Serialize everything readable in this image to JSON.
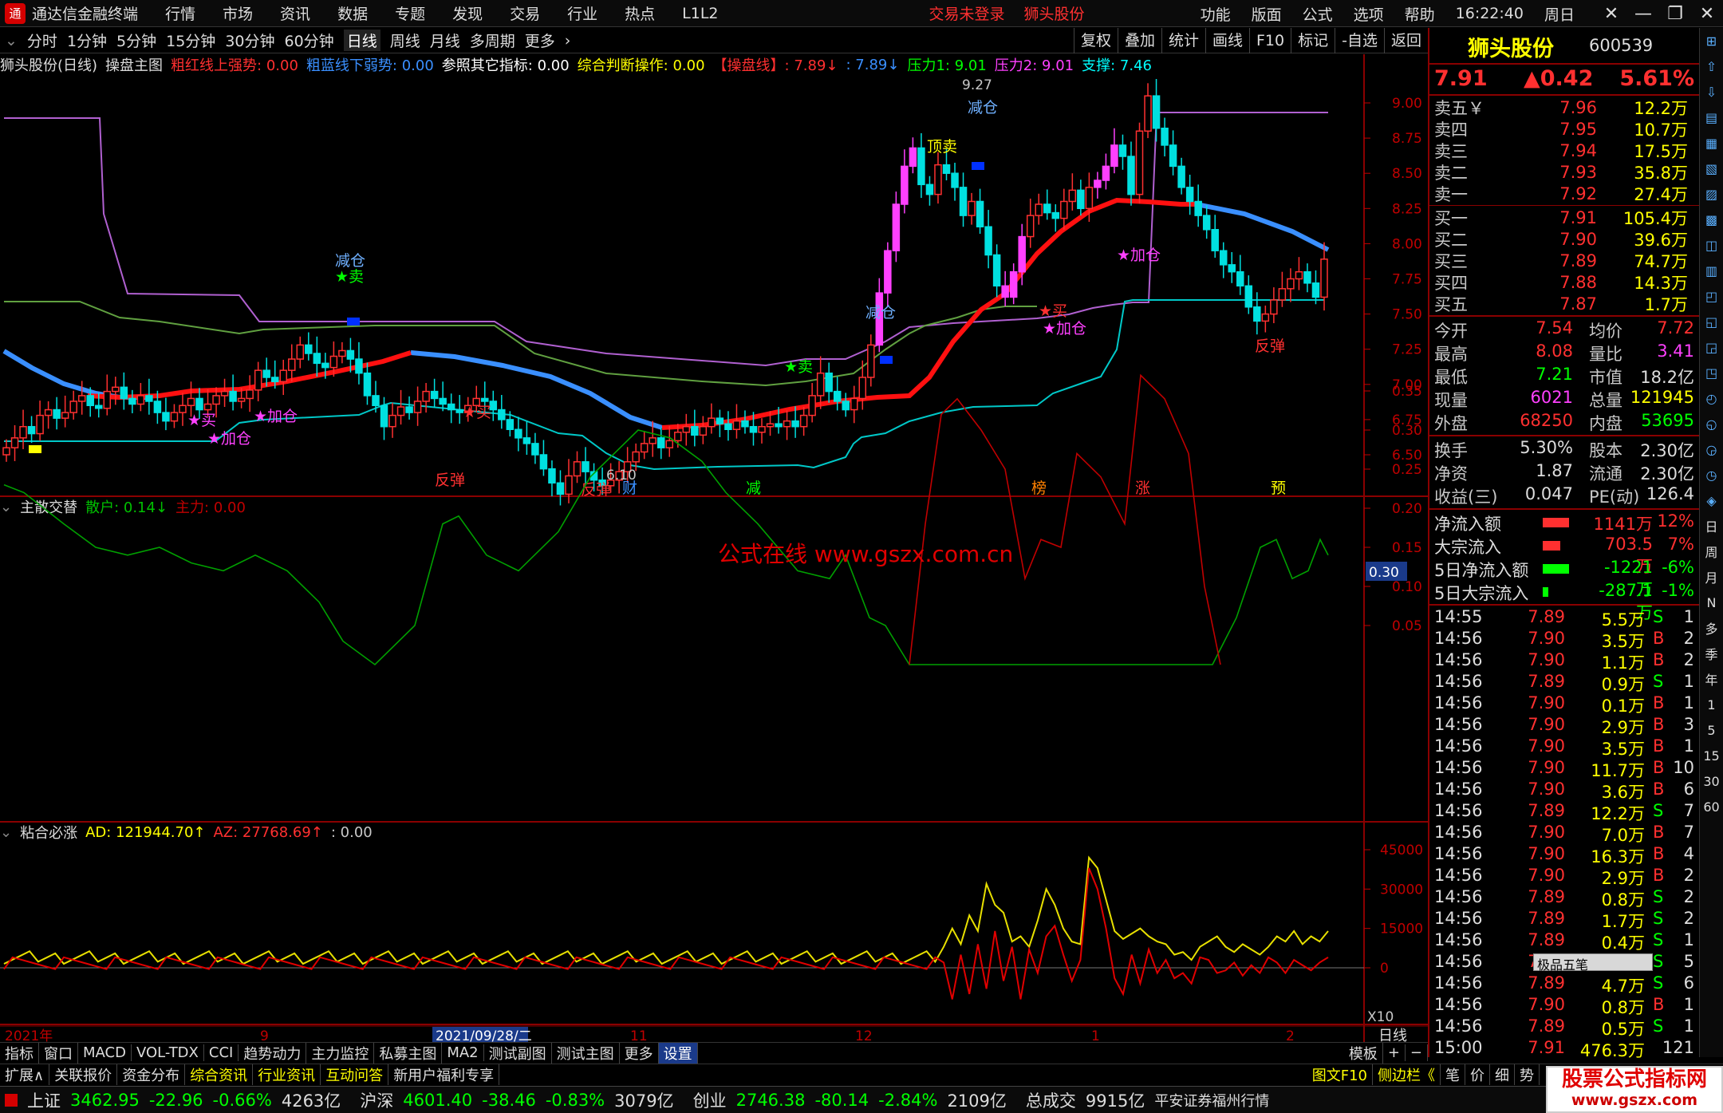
{
  "titlebar": {
    "logo": "通",
    "app": "通达信金融终端",
    "menu": [
      "行情",
      "市场",
      "资讯",
      "数据",
      "专题",
      "发现",
      "交易",
      "行业",
      "热点",
      "L1L2"
    ],
    "login": "交易未登录",
    "stock": "狮头股份",
    "right": [
      "功能",
      "版面",
      "公式",
      "选项",
      "帮助"
    ],
    "time": "16:22:40",
    "weekday": "周日"
  },
  "period": {
    "items": [
      "分时",
      "1分钟",
      "5分钟",
      "15分钟",
      "30分钟",
      "60分钟",
      "日线",
      "周线",
      "月线",
      "多周期",
      "更多"
    ],
    "active": "日线",
    "tools": [
      "复权",
      "叠加",
      "统计",
      "画线",
      "F10",
      "标记",
      "-自选",
      "返回"
    ]
  },
  "panel1": {
    "name": "狮头股份(日线)",
    "formula": "操盘主图",
    "items": [
      {
        "t": "粗红线上强势: 0.00",
        "c": "#ff3030"
      },
      {
        "t": "粗蓝线下弱势: 0.00",
        "c": "#3a8fff"
      },
      {
        "t": "参照其它指标: 0.00",
        "c": "#ffffff"
      },
      {
        "t": "综合判断操作: 0.00",
        "c": "#ffff00"
      },
      {
        "t": "【操盘线】: 7.89↓",
        "c": "#ff3030"
      },
      {
        "t": ": 7.89↓",
        "c": "#3a8fff"
      },
      {
        "t": "压力1: 9.01",
        "c": "#00ff00"
      },
      {
        "t": "压力2: 9.01",
        "c": "#ff40ff"
      },
      {
        "t": "支撑: 7.46",
        "c": "#00ffff"
      }
    ]
  },
  "panel2": {
    "name": "主散交替",
    "items": [
      {
        "t": "散户: 0.14↓",
        "c": "#00c000"
      },
      {
        "t": "主力: 0.00",
        "c": "#c00000"
      }
    ],
    "watermark": "公式在线 www.gszx.com.cn",
    "axis_tag": "0.30"
  },
  "panel3": {
    "name": "粘合必涨",
    "items": [
      {
        "t": "AD: 121944.70↑",
        "c": "#ffff00"
      },
      {
        "t": "AZ: 27768.69↑",
        "c": "#ff3030"
      },
      {
        "t": ": 0.00",
        "c": "#c8c8c8"
      }
    ],
    "scale_tag": "X10"
  },
  "price_axis": [
    "9.00",
    "8.75",
    "8.50",
    "8.25",
    "8.00",
    "7.75",
    "7.50",
    "7.25",
    "7.00",
    "6.75",
    "6.50"
  ],
  "osc_axis": [
    "0.35",
    "0.30",
    "0.25",
    "0.20",
    "0.15",
    "0.10",
    "0.05"
  ],
  "vol_axis": [
    "45000",
    "30000",
    "15000",
    "0"
  ],
  "time_axis": {
    "labels": [
      "2021年",
      "9",
      "2021/09/28/二",
      "11",
      "12",
      "1",
      "2"
    ],
    "period": "日线"
  },
  "chart_labels": {
    "high": "9.27",
    "low": "6.10",
    "signals": [
      "减仓",
      "★卖",
      "★买",
      "★加仓",
      "★加仓",
      "反弹",
      "★买",
      "反弹",
      "★卖",
      "减仓",
      "顶卖",
      "减仓",
      "★买",
      "★加仓",
      "★加仓",
      "反弹"
    ],
    "bottom_tags": [
      "财",
      "减",
      "榜",
      "涨",
      "预"
    ]
  },
  "quote": {
    "name": "狮头股份",
    "code": "600539",
    "price": "7.91",
    "change": "▲0.42",
    "pct": "5.61%",
    "asks": [
      {
        "l": "卖五￥",
        "p": "7.96",
        "v": "12.2万"
      },
      {
        "l": "卖四",
        "p": "7.95",
        "v": "10.7万"
      },
      {
        "l": "卖三",
        "p": "7.94",
        "v": "17.5万"
      },
      {
        "l": "卖二",
        "p": "7.93",
        "v": "35.8万"
      },
      {
        "l": "卖一",
        "p": "7.92",
        "v": "27.4万"
      }
    ],
    "bids": [
      {
        "l": "买一",
        "p": "7.91",
        "v": "105.4万"
      },
      {
        "l": "买二",
        "p": "7.90",
        "v": "39.6万"
      },
      {
        "l": "买三",
        "p": "7.89",
        "v": "74.7万"
      },
      {
        "l": "买四",
        "p": "7.88",
        "v": "14.3万"
      },
      {
        "l": "买五",
        "p": "7.87",
        "v": "1.7万"
      }
    ],
    "stats": [
      [
        "今开",
        "7.54",
        "均价",
        "7.72"
      ],
      [
        "最高",
        "8.08",
        "量比",
        "3.41"
      ],
      [
        "最低",
        "7.21",
        "市值",
        "18.2亿"
      ],
      [
        "现量",
        "6021",
        "总量",
        "121945"
      ],
      [
        "外盘",
        "68250",
        "内盘",
        "53695"
      ]
    ],
    "stats2": [
      [
        "换手",
        "5.30%",
        "股本",
        "2.30亿"
      ],
      [
        "净资",
        "1.87",
        "流通",
        "2.30亿"
      ],
      [
        "收益(三)",
        "0.047",
        "PE(动)",
        "126.4"
      ]
    ],
    "flows": [
      {
        "l": "净流入额",
        "v": "1141万",
        "p": "12%",
        "c": "#ff3030",
        "bar": 0.3
      },
      {
        "l": "大宗流入",
        "v": "703.5万",
        "p": "7%",
        "c": "#ff3030",
        "bar": 0.2
      },
      {
        "l": "5日净流入额",
        "v": "-1221万",
        "p": "-6%",
        "c": "#00ff00",
        "bar": 0.3
      },
      {
        "l": "5日大宗流入",
        "v": "-287.1万",
        "p": "-1%",
        "c": "#00ff00",
        "bar": 0.06
      }
    ],
    "ticks": [
      [
        "14:55",
        "7.89",
        "5.5万",
        "S",
        "1"
      ],
      [
        "14:56",
        "7.90",
        "3.5万",
        "B",
        "2"
      ],
      [
        "14:56",
        "7.90",
        "1.1万",
        "B",
        "2"
      ],
      [
        "14:56",
        "7.89",
        "0.9万",
        "S",
        "1"
      ],
      [
        "14:56",
        "7.90",
        "0.1万",
        "B",
        "1"
      ],
      [
        "14:56",
        "7.90",
        "2.9万",
        "B",
        "3"
      ],
      [
        "14:56",
        "7.90",
        "3.5万",
        "B",
        "1"
      ],
      [
        "14:56",
        "7.90",
        "11.7万",
        "B",
        "10"
      ],
      [
        "14:56",
        "7.90",
        "3.6万",
        "B",
        "6"
      ],
      [
        "14:56",
        "7.89",
        "12.2万",
        "S",
        "7"
      ],
      [
        "14:56",
        "7.90",
        "7.0万",
        "B",
        "7"
      ],
      [
        "14:56",
        "7.90",
        "16.3万",
        "B",
        "4"
      ],
      [
        "14:56",
        "7.90",
        "2.9万",
        "B",
        "2"
      ],
      [
        "14:56",
        "7.89",
        "0.8万",
        "S",
        "2"
      ],
      [
        "14:56",
        "7.89",
        "1.7万",
        "S",
        "2"
      ],
      [
        "14:56",
        "7.89",
        "0.4万",
        "S",
        "1"
      ],
      [
        "14:56",
        "7.89",
        "",
        "S",
        "5"
      ],
      [
        "14:56",
        "7.89",
        "4.7万",
        "S",
        "6"
      ],
      [
        "14:56",
        "7.90",
        "0.8万",
        "B",
        "1"
      ],
      [
        "14:56",
        "7.89",
        "0.5万",
        "S",
        "1"
      ],
      [
        "15:00",
        "7.91",
        "476.3万",
        "",
        "121"
      ]
    ],
    "ime": "极品五笔"
  },
  "rightbar": [
    "日",
    "周",
    "月",
    "N",
    "多",
    "季",
    "年",
    "1",
    "5",
    "15",
    "30",
    "60"
  ],
  "bottomtabs": [
    "指标",
    "窗口",
    "MACD",
    "VOL-TDX",
    "CCI",
    "趋势动力",
    "主力监控",
    "私募主图",
    "MA2",
    "测试副图",
    "测试主图",
    "更多",
    "设置"
  ],
  "bottomtabs_active": "设置",
  "bottomright": [
    "模板",
    "+",
    "−"
  ],
  "linktabs": [
    "扩展∧",
    "关联报价",
    "资金分布",
    "综合资讯",
    "行业资讯",
    "互动问答",
    "新用户福利专享"
  ],
  "linktabs_right": [
    "图文F10",
    "侧边栏《",
    "笔",
    "价",
    "细",
    "势"
  ],
  "status": {
    "sh": {
      "n": "上证",
      "v": "3462.95",
      "c": "-22.96",
      "p": "-0.66%",
      "a": "4263亿"
    },
    "sz": {
      "n": "沪深",
      "v": "4601.40",
      "c": "-38.46",
      "p": "-0.83%",
      "a": "3079亿"
    },
    "cy": {
      "n": "创业",
      "v": "2746.38",
      "c": "-80.14",
      "p": "-2.84%",
      "a": "2109亿"
    },
    "total_label": "总成交",
    "total": "9915亿",
    "broker": "平安证券福州行情"
  },
  "watermark_logo": {
    "t1": "股票公式指标网",
    "t2": "www.gszx.com"
  }
}
